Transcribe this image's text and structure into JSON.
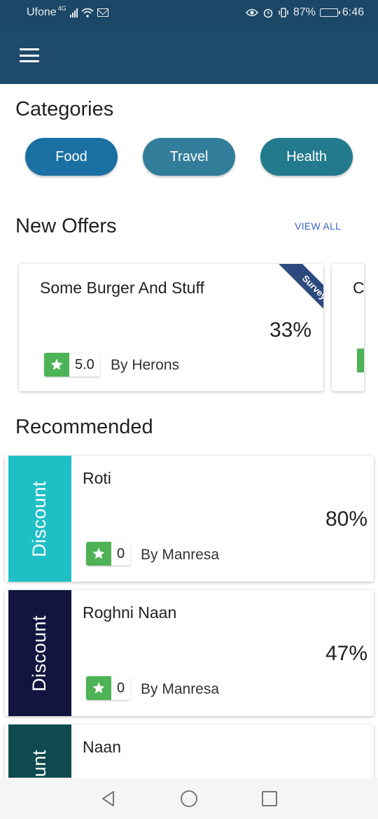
{
  "status_bar": {
    "carrier": "Ufone",
    "network_type": "4G",
    "battery": "87%",
    "time": "6:46",
    "icons": [
      "signal-icon",
      "wifi-icon",
      "mail-icon",
      "eye-icon",
      "alarm-icon",
      "vibrate-icon",
      "battery-icon"
    ],
    "battery_level": 0.87
  },
  "app_bar": {
    "menu_icon": "hamburger-menu-icon",
    "color": "#1e4a6c"
  },
  "categories": {
    "title": "Categories",
    "items": [
      {
        "label": "Food",
        "color": "#1a6fa3"
      },
      {
        "label": "Travel",
        "color": "#327d9a"
      },
      {
        "label": "Health",
        "color": "#237a8d"
      }
    ]
  },
  "new_offers": {
    "title": "New Offers",
    "view_all": "VIEW ALL",
    "cards": [
      {
        "title": "Some Burger And Stuff",
        "percent": "33%",
        "ribbon": "Survey",
        "rating": "5.0",
        "by": "By Herons"
      },
      {
        "title_partial": "C"
      }
    ]
  },
  "recommended": {
    "title": "Recommended",
    "cards": [
      {
        "tag": "Discount",
        "tag_color": "#1fbfc6",
        "title": "Roti",
        "percent": "80%",
        "rating": "0",
        "by": "By Manresa"
      },
      {
        "tag": "Discount",
        "tag_color": "#131540",
        "title": "Roghni Naan",
        "percent": "47%",
        "rating": "0",
        "by": "By Manresa"
      },
      {
        "tag": "Discount",
        "tag_color": "#0e4a4f",
        "title": "Naan"
      }
    ]
  },
  "colors": {
    "accent": "#3b63c4",
    "rating_green": "#4db356",
    "ribbon": "#2d4a7e"
  },
  "nav_bar": {
    "icons": [
      "back-icon",
      "home-icon",
      "recents-icon"
    ]
  }
}
